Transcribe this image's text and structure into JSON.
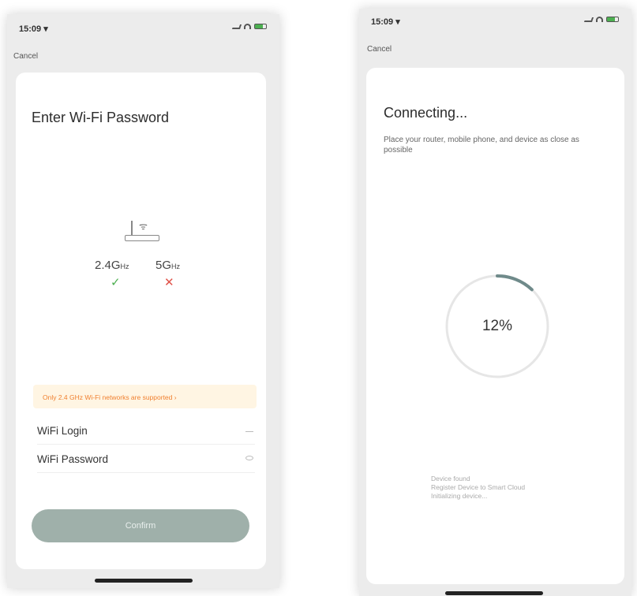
{
  "left_screen": {
    "status": {
      "time": "15:09 ▾"
    },
    "cancel_label": "Cancel",
    "title": "Enter Wi-Fi Password",
    "bands": {
      "band_24": {
        "value": "2.4G",
        "unit": "Hz",
        "supported": "✓"
      },
      "band_5": {
        "value": "5G",
        "unit": "Hz",
        "supported": "✕"
      }
    },
    "notice": "Only 2.4 GHz Wi-Fi networks are supported ›",
    "fields": {
      "login_label": "WiFi Login",
      "password_label": "WiFi Password"
    },
    "confirm_label": "Confirm"
  },
  "right_screen": {
    "status": {
      "time": "15:09 ▾"
    },
    "cancel_label": "Cancel",
    "title": "Connecting...",
    "subtitle": "Place your router, mobile phone, and device as close as possible",
    "progress": {
      "percent": 12,
      "label": "12%"
    },
    "steps": [
      "Device found",
      "Register Device to Smart Cloud",
      "Initializing device..."
    ]
  },
  "colors": {
    "check": "#4caf50",
    "cross": "#e0534a",
    "notice_text": "#f08030",
    "notice_bg": "#fff5e3",
    "confirm_bg": "#9fb0aa",
    "progress_arc": "#6f8a8a"
  },
  "icons": [
    "signal-icon",
    "wifi-icon",
    "battery-icon",
    "router-icon",
    "check-icon",
    "cross-icon",
    "key-icon",
    "eye-icon"
  ]
}
